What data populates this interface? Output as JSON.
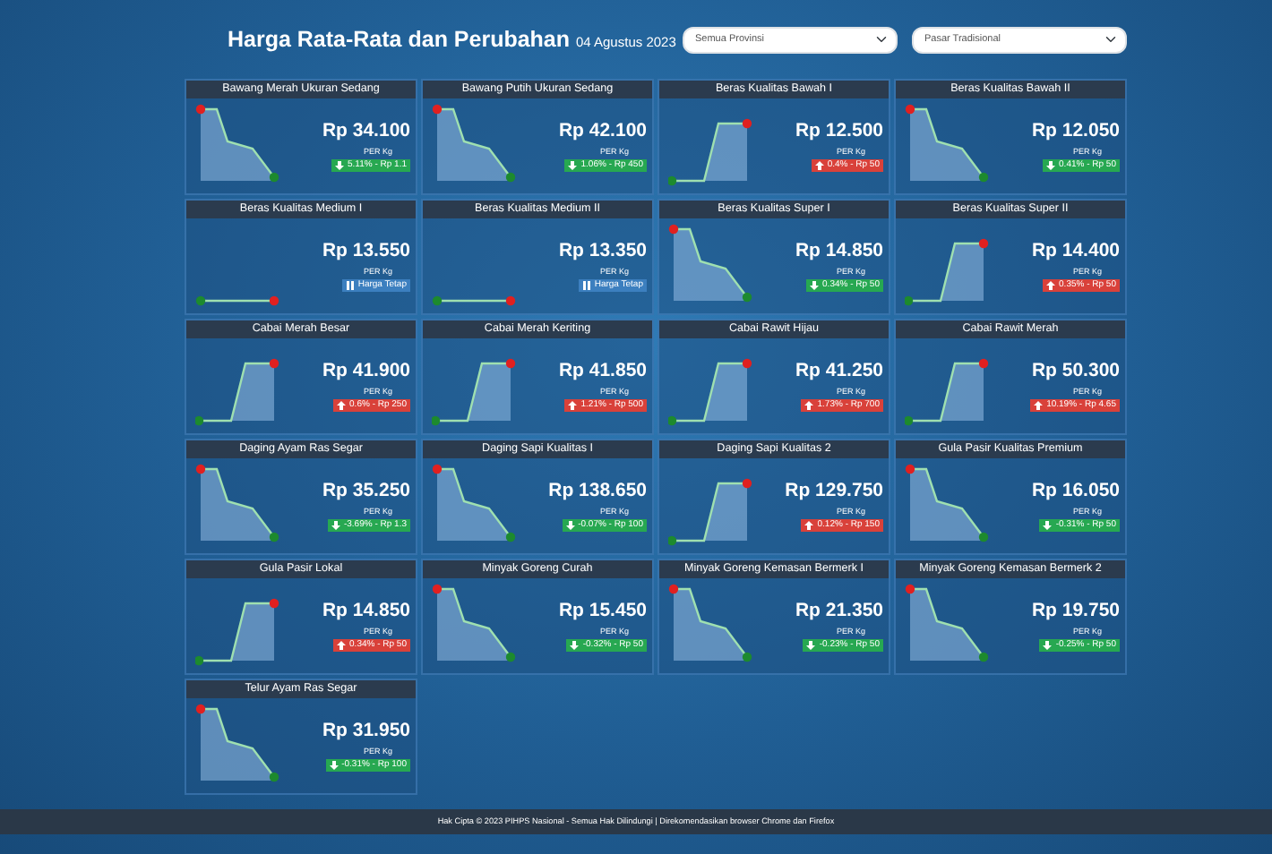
{
  "header": {
    "title": "Harga Rata-Rata dan Perubahan",
    "date": "04 Agustus 2023"
  },
  "filters": [
    {
      "value": "Semua Provinsi"
    },
    {
      "value": "Pasar Tradisional"
    }
  ],
  "commodities": [
    {
      "name": "Bawang Merah Ukuran Sedang",
      "price": "Rp 34.100",
      "unit": "PER Kg",
      "kind": "down",
      "change": "5.11% - Rp 1.1"
    },
    {
      "name": "Bawang Putih Ukuran Sedang",
      "price": "Rp 42.100",
      "unit": "PER Kg",
      "kind": "down",
      "change": "1.06% - Rp 450"
    },
    {
      "name": "Beras Kualitas Bawah I",
      "price": "Rp 12.500",
      "unit": "PER Kg",
      "kind": "up",
      "change": "0.4% - Rp 50"
    },
    {
      "name": "Beras Kualitas Bawah II",
      "price": "Rp 12.050",
      "unit": "PER Kg",
      "kind": "down",
      "change": "0.41% - Rp 50"
    },
    {
      "name": "Beras Kualitas Medium I",
      "price": "Rp 13.550",
      "unit": "PER Kg",
      "kind": "flat",
      "change": "Harga Tetap"
    },
    {
      "name": "Beras Kualitas Medium II",
      "price": "Rp 13.350",
      "unit": "PER Kg",
      "kind": "flat",
      "change": "Harga Tetap"
    },
    {
      "name": "Beras Kualitas Super I",
      "price": "Rp 14.850",
      "unit": "PER Kg",
      "kind": "down",
      "change": "0.34% - Rp 50"
    },
    {
      "name": "Beras Kualitas Super II",
      "price": "Rp 14.400",
      "unit": "PER Kg",
      "kind": "up",
      "change": "0.35% - Rp 50"
    },
    {
      "name": "Cabai Merah Besar",
      "price": "Rp 41.900",
      "unit": "PER Kg",
      "kind": "up",
      "change": "0.6% - Rp 250"
    },
    {
      "name": "Cabai Merah Keriting",
      "price": "Rp 41.850",
      "unit": "PER Kg",
      "kind": "up",
      "change": "1.21% - Rp 500"
    },
    {
      "name": "Cabai Rawit Hijau",
      "price": "Rp 41.250",
      "unit": "PER Kg",
      "kind": "up",
      "change": "1.73% - Rp 700"
    },
    {
      "name": "Cabai Rawit Merah",
      "price": "Rp 50.300",
      "unit": "PER Kg",
      "kind": "up",
      "change": "10.19% - Rp 4.65"
    },
    {
      "name": "Daging Ayam Ras Segar",
      "price": "Rp 35.250",
      "unit": "PER Kg",
      "kind": "down",
      "change": "-3.69% - Rp 1.3"
    },
    {
      "name": "Daging Sapi Kualitas I",
      "price": "Rp 138.650",
      "unit": "PER Kg",
      "kind": "down",
      "change": "-0.07% - Rp 100"
    },
    {
      "name": "Daging Sapi Kualitas 2",
      "price": "Rp 129.750",
      "unit": "PER Kg",
      "kind": "up",
      "change": "0.12% - Rp 150"
    },
    {
      "name": "Gula Pasir Kualitas Premium",
      "price": "Rp 16.050",
      "unit": "PER Kg",
      "kind": "down",
      "change": "-0.31% - Rp 50"
    },
    {
      "name": "Gula Pasir Lokal",
      "price": "Rp 14.850",
      "unit": "PER Kg",
      "kind": "up",
      "change": "0.34% - Rp 50"
    },
    {
      "name": "Minyak Goreng Curah",
      "price": "Rp 15.450",
      "unit": "PER Kg",
      "kind": "down",
      "change": "-0.32% - Rp 50"
    },
    {
      "name": "Minyak Goreng Kemasan Bermerk I",
      "price": "Rp 21.350",
      "unit": "PER Kg",
      "kind": "down",
      "change": "-0.23% - Rp 50"
    },
    {
      "name": "Minyak Goreng Kemasan Bermerk 2",
      "price": "Rp 19.750",
      "unit": "PER Kg",
      "kind": "down",
      "change": "-0.25% - Rp 50"
    },
    {
      "name": "Telur Ayam Ras Segar",
      "price": "Rp 31.950",
      "unit": "PER Kg",
      "kind": "down",
      "change": "-0.31% - Rp 100"
    }
  ],
  "footer": "Hak Cipta © 2023 PIHPS Nasional - Semua Hak Dilindungi | Direkomendasikan browser Chrome dan Firefox"
}
